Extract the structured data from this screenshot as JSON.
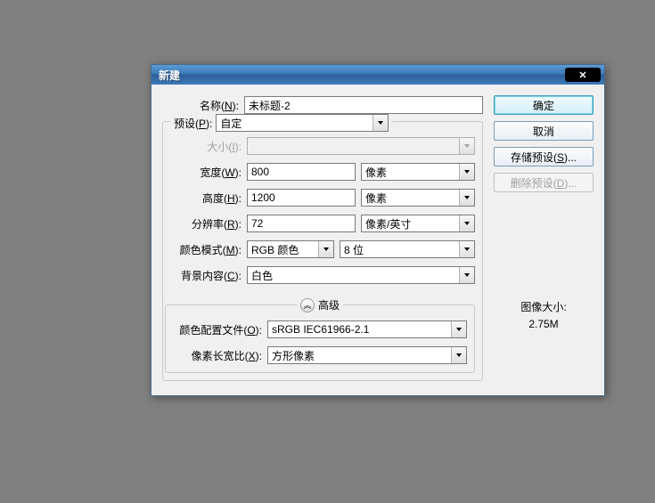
{
  "title": "新建",
  "labels": {
    "name": "名称(N):",
    "preset": "预设(P):",
    "size": "大小(I):",
    "width": "宽度(W):",
    "height": "高度(H):",
    "resolution": "分辨率(R):",
    "colorMode": "颜色模式(M):",
    "bgContent": "背景内容(C):",
    "advanced": "高级",
    "colorProfile": "颜色配置文件(O):",
    "pixelAspect": "像素长宽比(X):",
    "imageSizeLabel": "图像大小:"
  },
  "values": {
    "name": "未标题-2",
    "preset": "自定",
    "size": "",
    "width": "800",
    "widthUnit": "像素",
    "height": "1200",
    "heightUnit": "像素",
    "resolution": "72",
    "resolutionUnit": "像素/英寸",
    "colorMode": "RGB 颜色",
    "colorBits": "8 位",
    "bgContent": "白色",
    "colorProfile": "sRGB IEC61966-2.1",
    "pixelAspect": "方形像素",
    "imageSize": "2.75M"
  },
  "buttons": {
    "ok": "确定",
    "cancel": "取消",
    "savePreset": "存储预设(S)...",
    "deletePreset": "删除预设(D)..."
  }
}
